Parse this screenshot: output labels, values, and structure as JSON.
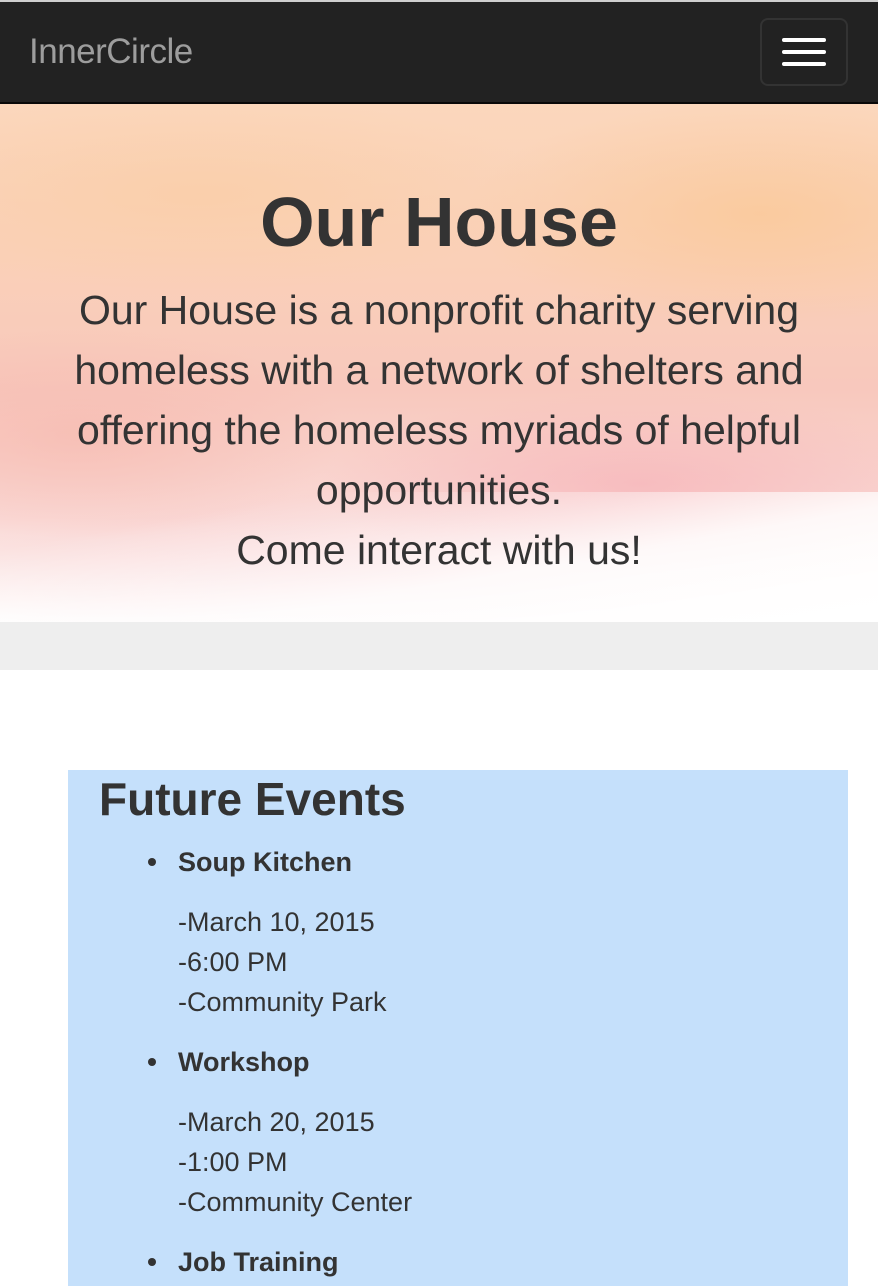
{
  "navbar": {
    "brand": "InnerCircle",
    "menu_toggle_icon": "hamburger-menu-icon"
  },
  "hero": {
    "title": "Our House",
    "description_lines": [
      "Our House is a nonprofit charity serving",
      "homeless with a network of shelters and",
      "offering the homeless myriads of helpful",
      "opportunities.",
      "Come interact with us!"
    ]
  },
  "events": {
    "heading": "Future Events",
    "items": [
      {
        "name": "Soup Kitchen",
        "date": "-March 10, 2015",
        "time": "-6:00 PM",
        "location": "-Community Park"
      },
      {
        "name": "Workshop",
        "date": "-March 20, 2015",
        "time": "-1:00 PM",
        "location": "-Community Center"
      },
      {
        "name": "Job Training"
      }
    ]
  },
  "colors": {
    "navbar_bg": "#222222",
    "brand_text": "#9d9d9d",
    "events_bg": "#c5e0fb",
    "band_bg": "#eeeeee",
    "text": "#333333"
  }
}
